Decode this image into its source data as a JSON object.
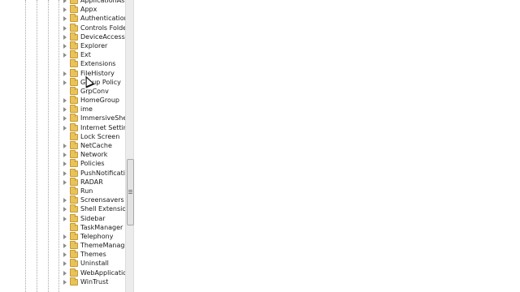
{
  "tree": {
    "items": [
      {
        "label": "ApplicationAssoc",
        "expandable": true
      },
      {
        "label": "Appx",
        "expandable": true
      },
      {
        "label": "Authentication",
        "expandable": true
      },
      {
        "label": "Controls Folder",
        "expandable": true
      },
      {
        "label": "DeviceAccess",
        "expandable": true
      },
      {
        "label": "Explorer",
        "expandable": true
      },
      {
        "label": "Ext",
        "expandable": true
      },
      {
        "label": "Extensions",
        "expandable": false
      },
      {
        "label": "FileHistory",
        "expandable": true
      },
      {
        "label": "Group Policy",
        "expandable": true
      },
      {
        "label": "GrpConv",
        "expandable": false
      },
      {
        "label": "HomeGroup",
        "expandable": true
      },
      {
        "label": "ime",
        "expandable": true
      },
      {
        "label": "ImmersiveShell",
        "expandable": true
      },
      {
        "label": "Internet Settings",
        "expandable": true
      },
      {
        "label": "Lock Screen",
        "expandable": false
      },
      {
        "label": "NetCache",
        "expandable": true
      },
      {
        "label": "Network",
        "expandable": true
      },
      {
        "label": "Policies",
        "expandable": true
      },
      {
        "label": "PushNotification",
        "expandable": true
      },
      {
        "label": "RADAR",
        "expandable": true
      },
      {
        "label": "Run",
        "expandable": false
      },
      {
        "label": "Screensavers",
        "expandable": true
      },
      {
        "label": "Shell Extensions",
        "expandable": true
      },
      {
        "label": "Sidebar",
        "expandable": true
      },
      {
        "label": "TaskManager",
        "expandable": false
      },
      {
        "label": "Telephony",
        "expandable": true
      },
      {
        "label": "ThemeManager",
        "expandable": true
      },
      {
        "label": "Themes",
        "expandable": true
      },
      {
        "label": "Uninstall",
        "expandable": true
      },
      {
        "label": "WebApplication",
        "expandable": true
      },
      {
        "label": "WinTrust",
        "expandable": true
      }
    ]
  },
  "icons": {
    "folder": "folder-icon",
    "expander": "expand-arrow-icon",
    "cursor": "mouse-pointer-icon",
    "grip": "scrollbar-grip-icon"
  },
  "colors": {
    "folder": "#e8c35c",
    "background": "#ffffff",
    "scrollbar": "#ececec"
  }
}
